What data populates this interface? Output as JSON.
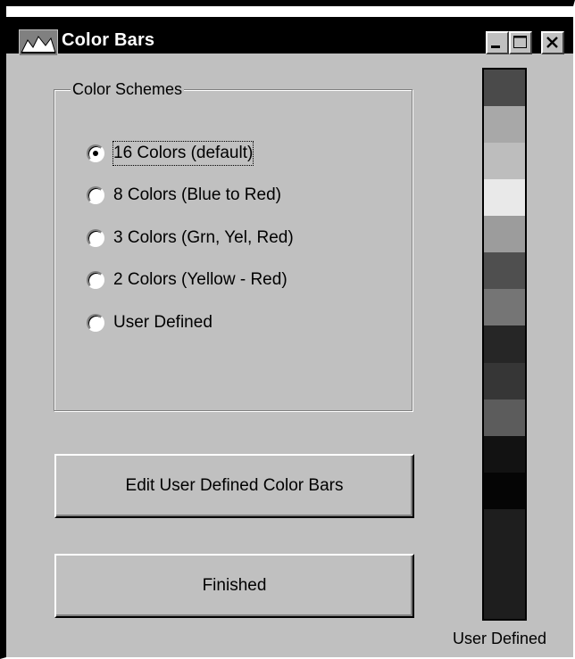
{
  "window": {
    "title": "Color Bars",
    "icon": "color-bars-app-icon",
    "controls": [
      "minimize-icon",
      "maximize-icon",
      "close-icon"
    ]
  },
  "color_schemes": {
    "label": "Color Schemes",
    "options": [
      {
        "label": "16 Colors (default)",
        "selected": true
      },
      {
        "label": "8 Colors (Blue to Red)",
        "selected": false
      },
      {
        "label": "3 Colors (Grn, Yel, Red)",
        "selected": false
      },
      {
        "label": "2 Colors (Yellow - Red)",
        "selected": false
      },
      {
        "label": "User Defined",
        "selected": false
      }
    ]
  },
  "buttons": {
    "edit_label": "Edit User Defined Color Bars",
    "finished_label": "Finished"
  },
  "color_bar": {
    "caption": "User Defined",
    "swatches": [
      "#4a4a4a",
      "#a8a8a8",
      "#bdbdbd",
      "#e9e9e9",
      "#9c9c9c",
      "#4f4f4f",
      "#757575",
      "#262626",
      "#363636",
      "#5c5c5c",
      "#121212",
      "#050505",
      "#1e1e1e",
      "#1e1e1e",
      "#1e1e1e"
    ]
  }
}
